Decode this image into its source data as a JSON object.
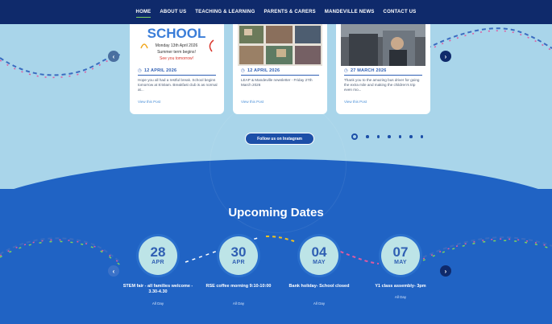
{
  "nav": {
    "items": [
      "Home",
      "About Us",
      "Teaching & Learning",
      "Parents & Carers",
      "Mandeville News",
      "Contact Us"
    ],
    "active": "Home"
  },
  "posts": [
    {
      "date": "12 APRIL 2026",
      "image_text": [
        "SCHOOL",
        "Monday 13th April 2026",
        "Summer term begins!",
        "See you tomorrow!"
      ],
      "text": "Hope you all had a restful break. School begins tomorrow at 8:50am. Breakfast club is as normal at...",
      "link": "View this Post"
    },
    {
      "date": "12 APRIL 2026",
      "text": "LEAP & Mandeville newsletter - Friday 27th March 2026",
      "link": "View this Post"
    },
    {
      "date": "27 MARCH 2026",
      "text": "Thank you to the amazing bus driver for going the extra mile and making the children's trip even mo...",
      "link": "View this Post"
    }
  ],
  "follow_button": "Follow us on Instagram",
  "carousel": {
    "dots": 7,
    "active": 1
  },
  "upcoming": {
    "title": "Upcoming Dates",
    "events": [
      {
        "day": "28",
        "month": "APR",
        "title": "STEM fair - all families welcome - 3.30-4.30",
        "meta": "All Day"
      },
      {
        "day": "30",
        "month": "APR",
        "title": "RSE coffee morning 9:10-10:00",
        "meta": "All Day"
      },
      {
        "day": "04",
        "month": "MAY",
        "title": "Bank holiday- School closed",
        "meta": "All Day"
      },
      {
        "day": "07",
        "month": "MAY",
        "title": "Y1 class assembly- 3pm",
        "meta": "All Day"
      }
    ]
  },
  "icons": {
    "prev": "chevron-left-icon",
    "next": "chevron-right-icon",
    "date": "clock-icon"
  },
  "colors": {
    "nav_bg": "#0f2a6b",
    "top_bg": "#a9d5ea",
    "lower_bg": "#2063c4",
    "accent": "#7dd35c",
    "circle_bg": "#bde4e7"
  }
}
